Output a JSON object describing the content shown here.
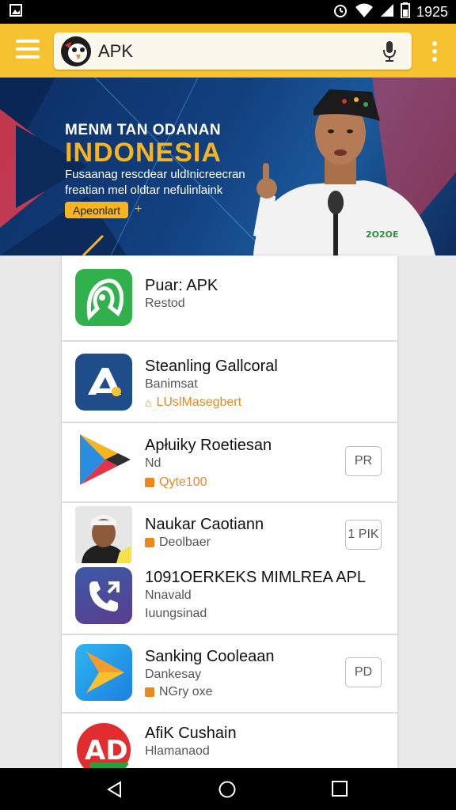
{
  "status_bar": {
    "time": "1925"
  },
  "search": {
    "query": "APK"
  },
  "banner": {
    "kicker": "MENM TAN ODANAN",
    "title": "INDONESIA",
    "subtitle_line1": "Fusaanag rescdear uldInicreecran",
    "subtitle_line2": "freatian mel oldtar nefulinlaink",
    "button_label": "Apeonlart",
    "plus": "+",
    "photo_badge": "2O2OE"
  },
  "apps": [
    {
      "title": "Puar: APK",
      "subtitle": "Restod",
      "tag": "",
      "button": ""
    },
    {
      "title": "Steanling Gallcoral",
      "subtitle": "Banimsat",
      "tag": "LUslMasegbert",
      "button": ""
    },
    {
      "title": "Apłuiky Roetiesan",
      "subtitle": "Nd",
      "tag": "Qyte100",
      "button": "PR"
    },
    {
      "title": "Naukar Caotiann",
      "subtitle": "Deolbaer",
      "tag": "",
      "button": "1 PIK"
    },
    {
      "title": "1091OERKEKS MIMLREA APL",
      "subtitle": "Nnavald",
      "tag": "Iuungsinad",
      "button": ""
    },
    {
      "title": "Sanking Cooleaan",
      "subtitle": "Dankesay",
      "tag": "NGry oxe",
      "button": "PD"
    },
    {
      "title": "AfiK Cushain",
      "subtitle": "Hlamanaod",
      "tag": "",
      "button": ""
    }
  ],
  "icons": {
    "menu": "hamburger-menu-icon",
    "mic": "microphone-icon",
    "more": "more-vertical-icon",
    "nav_back": "back-triangle-icon",
    "nav_home": "home-circle-icon",
    "nav_recents": "recents-square-icon"
  },
  "colors": {
    "toolbar": "#f6c230",
    "accent_orange": "#e8881d"
  }
}
